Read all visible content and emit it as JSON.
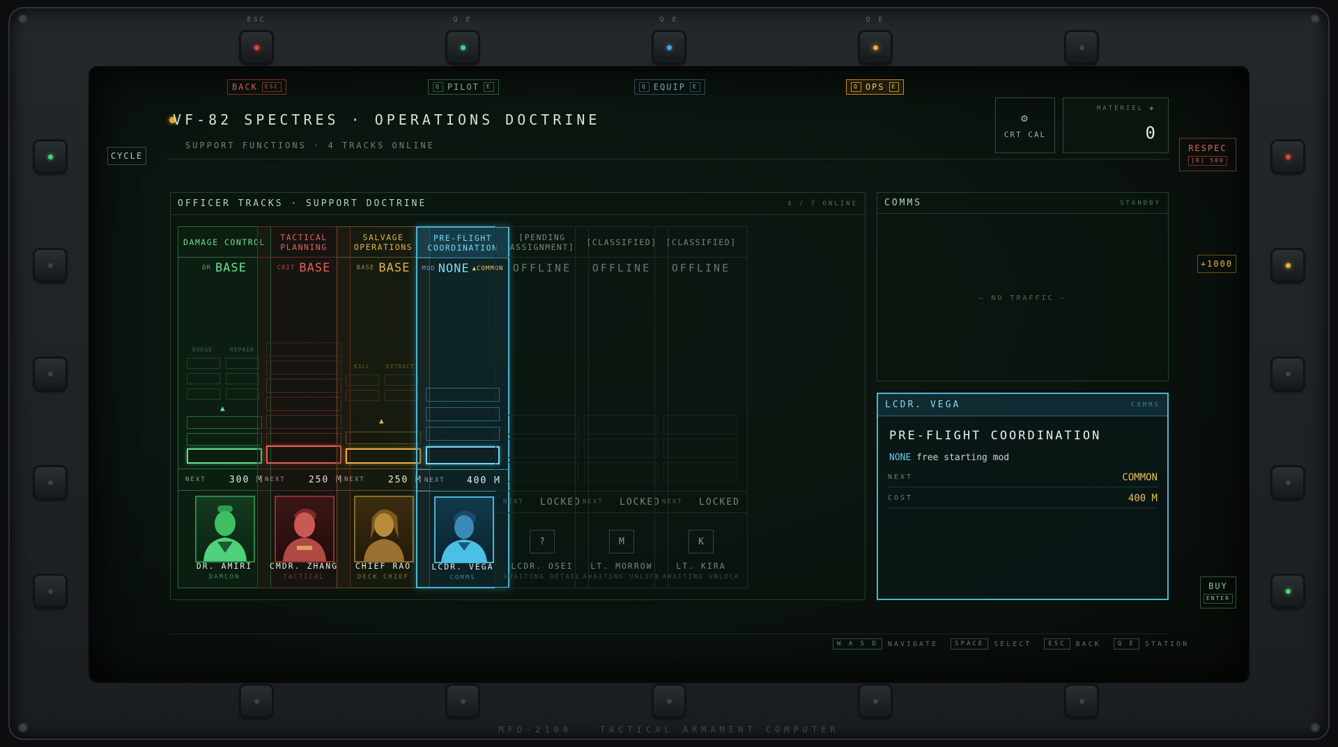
{
  "colors": {
    "green": "#5fe08a",
    "red": "#e0625a",
    "amber": "#e6b34a",
    "cyan": "#5ad0ec",
    "dim": "#6a7d70"
  },
  "hardware": {
    "top_hints": [
      "ESC",
      "Q E",
      "Q E",
      "Q E"
    ],
    "footer_label": "MFD-2100 · TACTICAL ARMAMENT COMPUTER"
  },
  "tabs": [
    {
      "label": "BACK",
      "key": "ESC"
    },
    {
      "label": "PILOT",
      "key_l": "Q",
      "key_r": "E"
    },
    {
      "label": "EQUIP",
      "key_l": "Q",
      "key_r": "E"
    },
    {
      "label": "OPS",
      "key_l": "Q",
      "key_r": "E"
    }
  ],
  "header": {
    "title": "VF-82 SPECTRES · OPERATIONS DOCTRINE",
    "subtitle": "SUPPORT FUNCTIONS · 4 TRACKS ONLINE",
    "crt_label": "CRT CAL",
    "crt_icon": "gear-icon",
    "materiel_label": "MATERIEL ◆",
    "materiel_value": "0"
  },
  "side": {
    "cycle": "CYCLE",
    "respec": "RESPEC",
    "respec_key": "[R] 500",
    "bonus": "+1000",
    "buy": "BUY",
    "buy_key": "ENTER"
  },
  "tracks": {
    "title": "OFFICER TRACKS · SUPPORT DOCTRINE",
    "count": "4 / 7 ONLINE",
    "columns": [
      {
        "header": "DAMAGE CONTROL",
        "mod_prefix": "DR",
        "mod": "BASE",
        "slot_labels": [
          "DODGE",
          "REPAIR"
        ],
        "next_label": "NEXT",
        "next_cost": "300 M",
        "name": "DR. AMIRI",
        "role": "DAMCON",
        "color": "green"
      },
      {
        "header": "TACTICAL PLANNING",
        "mod_prefix": "CRIT",
        "mod": "BASE",
        "next_label": "NEXT",
        "next_cost": "250 M",
        "name": "CMDR. ZHANG",
        "role": "TACTICAL",
        "color": "red"
      },
      {
        "header": "SALVAGE OPERATIONS",
        "mod_prefix": "BASE",
        "mod": "BASE",
        "slot_labels": [
          "KILL",
          "EXTRACT"
        ],
        "next_label": "NEXT",
        "next_cost": "250 M",
        "name": "CHIEF RAO",
        "role": "DECK CHIEF",
        "color": "amber"
      },
      {
        "header": "PRE-FLIGHT COORDINATION",
        "mod_prefix": "MOD",
        "mod": "NONE",
        "mod_suffix": "▲COMMON",
        "next_label": "NEXT",
        "next_cost": "400 M",
        "name": "LCDR. VEGA",
        "role": "COMMS",
        "color": "cyan"
      },
      {
        "header": "[PENDING ASSIGNMENT]",
        "mod": "OFFLINE",
        "next_label": "NEXT",
        "next_cost": "LOCKED",
        "letter": "?",
        "name": "LCDR. OSEI",
        "role": "AWAITING DETAIL"
      },
      {
        "header": "[CLASSIFIED]",
        "mod": "OFFLINE",
        "next_label": "NEXT",
        "next_cost": "LOCKED",
        "letter": "M",
        "name": "LT. MORROW",
        "role": "AWAITING UNLOCK"
      },
      {
        "header": "[CLASSIFIED]",
        "mod": "OFFLINE",
        "next_label": "NEXT",
        "next_cost": "LOCKED",
        "letter": "K",
        "name": "LT. KIRA",
        "role": "AWAITING UNLOCK"
      }
    ]
  },
  "comms": {
    "title": "COMMS",
    "status": "STANDBY",
    "empty": "— NO TRAFFIC —"
  },
  "detail": {
    "officer": "LCDR. VEGA",
    "tag": "COMMS",
    "title": "PRE-FLIGHT COORDINATION",
    "mod": "NONE",
    "desc": "free starting mod",
    "next_label": "NEXT",
    "next_value": "COMMON",
    "cost_label": "COST",
    "cost_value": "400 M"
  },
  "footer": [
    {
      "key": "W A S D",
      "label": "NAVIGATE"
    },
    {
      "key": "SPACE",
      "label": "SELECT"
    },
    {
      "key": "ESC",
      "label": "BACK"
    },
    {
      "key": "Q E",
      "label": "STATION"
    }
  ]
}
